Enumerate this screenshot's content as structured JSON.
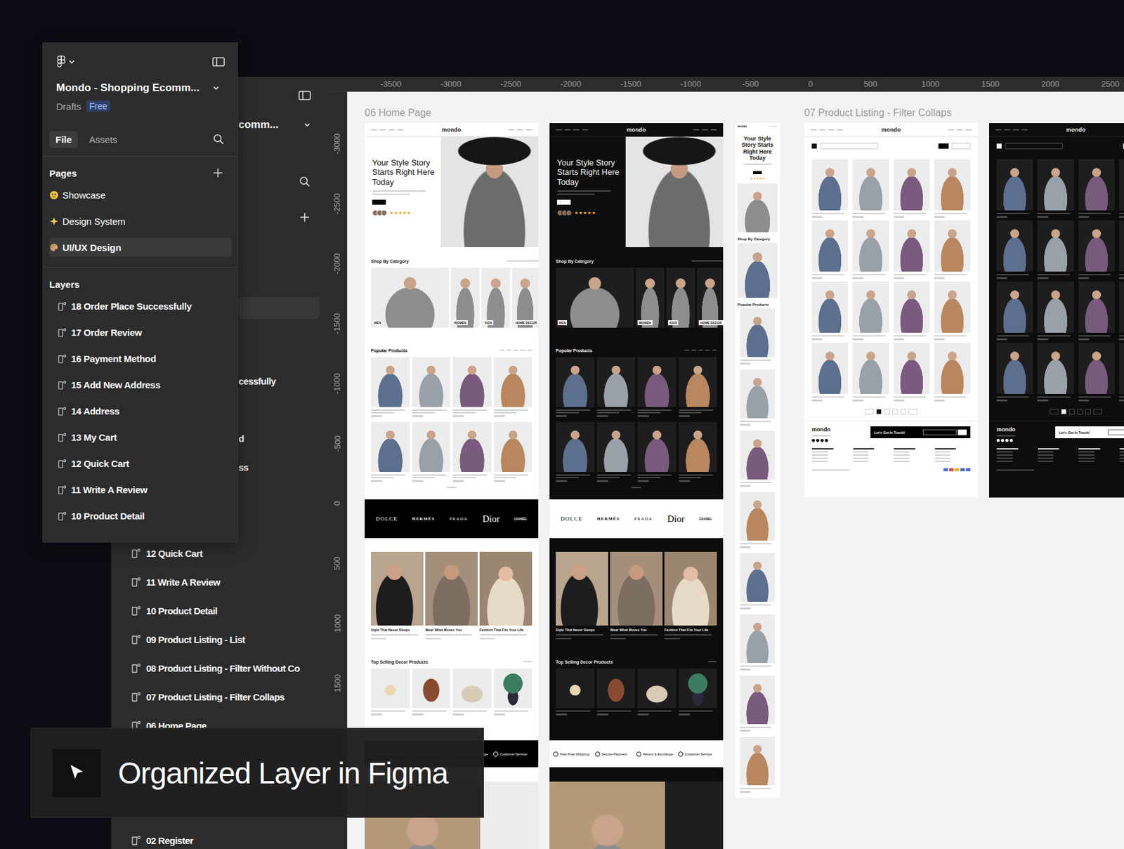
{
  "figma_panel": {
    "file_name": "Mondo - Shopping Ecomm...",
    "location": "Drafts",
    "plan": "Free",
    "tabs": [
      {
        "label": "File",
        "selected": true
      },
      {
        "label": "Assets",
        "selected": false
      }
    ],
    "pages_heading": "Pages",
    "pages": [
      {
        "label": "Showcase",
        "selected": false
      },
      {
        "label": "Design System",
        "selected": false
      },
      {
        "label": "UI/UX Design",
        "selected": true
      }
    ],
    "layers_heading": "Layers",
    "layers": [
      "18 Order Place Successfully",
      "17 Order Review",
      "16 Payment Method",
      "15 Add New Address",
      "14 Address",
      "13 My Cart",
      "12 Quick Cart",
      "11 Write A Review",
      "10 Product Detail"
    ]
  },
  "back_panel": {
    "file_name_visible": "comm...",
    "layer_fragments": [
      "cessfully",
      "d",
      "ss"
    ],
    "layers_upper": [
      "12 Quick Cart",
      "11 Write A Review",
      "10 Product Detail",
      "09 Product Listing - List",
      "08 Product Listing - Filter Without Co",
      "07 Product Listing - Filter Collaps",
      "06 Home Page"
    ],
    "layers_lower": [
      "02 Register"
    ]
  },
  "rulers": {
    "horizontal": [
      "-3500",
      "-3000",
      "-2500",
      "-2000",
      "-1500",
      "-1000",
      "-500",
      "0",
      "500",
      "1000",
      "1500",
      "2000",
      "2500"
    ],
    "vertical": [
      "-3000",
      "-2500",
      "-2000",
      "-1500",
      "-1000",
      "-500",
      "0",
      "500",
      "1000",
      "1500"
    ]
  },
  "canvas": {
    "sections": [
      {
        "label": "06 Home Page"
      },
      {
        "label": "07 Product Listing - Filter Collaps"
      }
    ],
    "home_frames": [
      {
        "theme": "light"
      },
      {
        "theme": "dark"
      }
    ],
    "mobile_frame": {
      "theme": "light"
    },
    "listing_frames": [
      {
        "theme": "light"
      },
      {
        "theme": "dark"
      }
    ],
    "home": {
      "logo": "mondo",
      "hero_title": "Your Style Story Starts Right Here Today",
      "stars": 5,
      "category_title": "Shop By Category",
      "categories": [
        "MEN",
        "WOMEN",
        "KIDS",
        "HOME DECOR"
      ],
      "popular_title": "Popular Products",
      "brands": [
        "DOLCE",
        "HERMÈS",
        "PRADA",
        "Dior",
        "CHANEL"
      ],
      "stories": [
        "Style That Never Sleeps",
        "Wear What Moves You",
        "Fashion That Fits Your Life"
      ],
      "decor_title": "Top Selling Decor Products",
      "features": [
        "Fast Free Shipping",
        "Secure Payment",
        "Return & Exchange",
        "Customer Service"
      ]
    },
    "listing": {
      "logo": "mondo",
      "footer_logo": "mondo",
      "contact_title": "Let's Get In Touch!"
    }
  },
  "caption": {
    "text": "Organized Layer in Figma"
  }
}
